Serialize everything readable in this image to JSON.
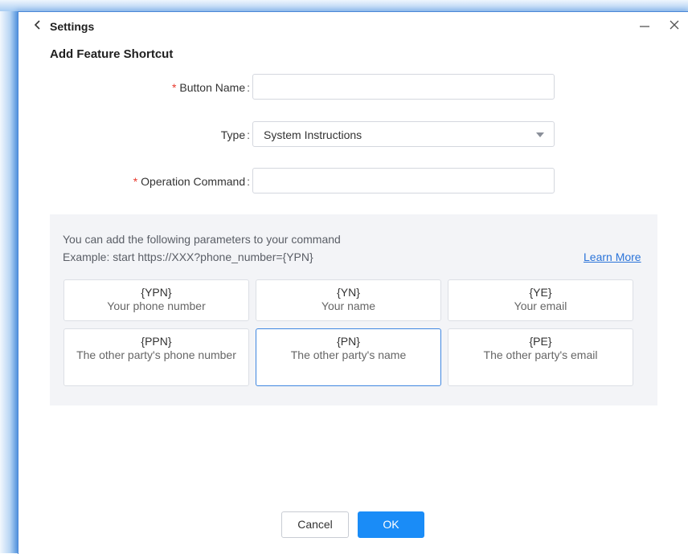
{
  "window": {
    "title": "Settings"
  },
  "page": {
    "heading": "Add Feature Shortcut"
  },
  "form": {
    "button_name_label": "Button Name",
    "button_name_value": "",
    "type_label": "Type",
    "type_value": "System Instructions",
    "operation_label": "Operation Command",
    "operation_value": "",
    "colon": ":"
  },
  "params": {
    "intro": "You can add the following parameters to your command",
    "example": "Example: start https://XXX?phone_number={YPN}",
    "learn_more": "Learn More",
    "cards": [
      {
        "code": "{YPN}",
        "desc": "Your phone number"
      },
      {
        "code": "{YN}",
        "desc": "Your name"
      },
      {
        "code": "{YE}",
        "desc": "Your email"
      },
      {
        "code": "{PPN}",
        "desc": "The other party's phone number"
      },
      {
        "code": "{PN}",
        "desc": "The other party's name"
      },
      {
        "code": "{PE}",
        "desc": "The other party's email"
      }
    ]
  },
  "footer": {
    "cancel": "Cancel",
    "ok": "OK"
  },
  "colors": {
    "accent": "#1a8cf7",
    "required": "#e8382c",
    "link": "#2b74d9"
  },
  "icons": {
    "back": "chevron-left-icon",
    "minimize": "minimize-icon",
    "close": "close-icon",
    "dropdown": "caret-down-icon"
  }
}
